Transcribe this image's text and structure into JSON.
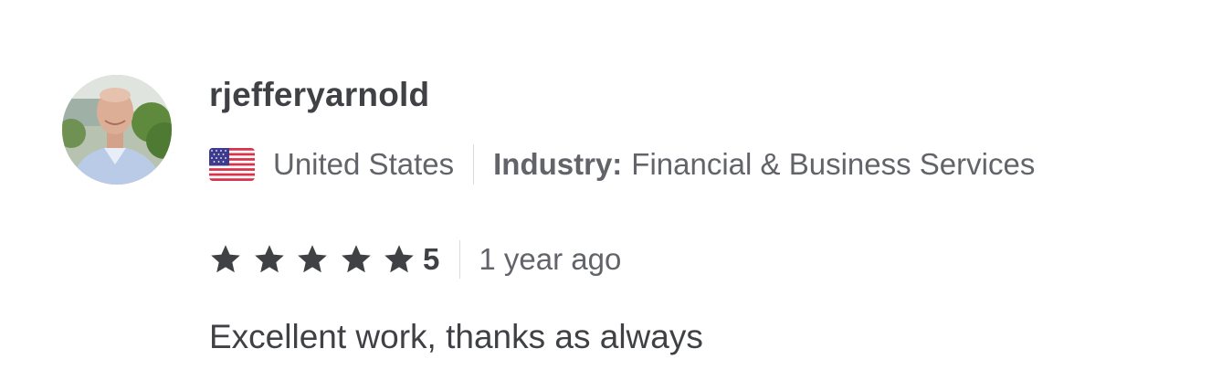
{
  "review": {
    "username": "rjefferyarnold",
    "country": "United States",
    "country_flag_icon": "us-flag-icon",
    "industry_label": "Industry:",
    "industry_value": "Financial & Business Services",
    "rating": {
      "score": "5",
      "stars_filled": 5,
      "stars_total": 5,
      "star_color": "#404145"
    },
    "time_ago": "1 year ago",
    "text": "Excellent work, thanks as always"
  }
}
